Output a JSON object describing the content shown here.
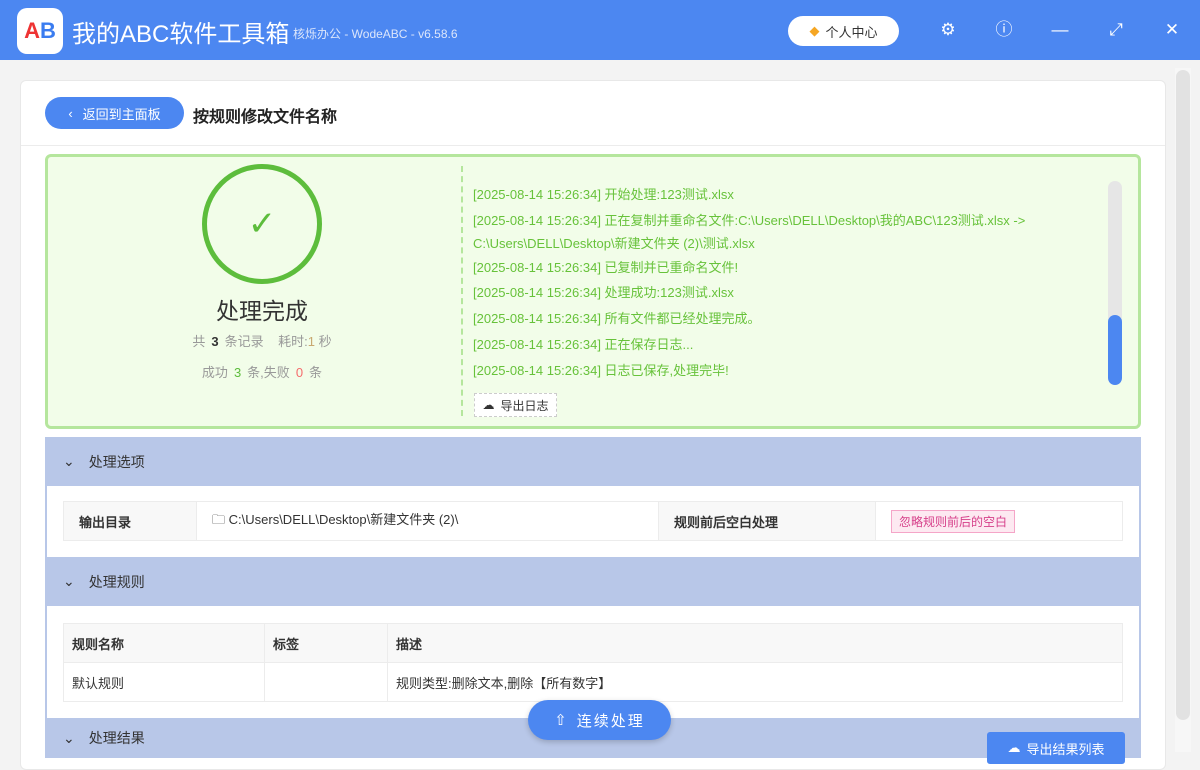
{
  "window": {
    "title": "我的ABC软件工具箱",
    "subtitle": "核烁办公 - WodeABC - v6.58.6",
    "logo_text": "AB",
    "user_center": "个人中心",
    "icons": [
      "settings-icon",
      "help-icon",
      "minimize-icon",
      "maximize-icon",
      "close-icon"
    ]
  },
  "header": {
    "back_label": "返回到主面板",
    "page_title": "按规则修改文件名称"
  },
  "summary": {
    "title": "处理完成",
    "total_prefix": "共",
    "total": "3",
    "total_suffix": "条记录",
    "time_label": "耗时:",
    "time": "1",
    "time_unit": "秒",
    "success_label": "成功",
    "success": "3",
    "success_unit": "条,",
    "fail_label": "失败",
    "fail": "0",
    "fail_unit": "条"
  },
  "log": {
    "lines": [
      "[2025-08-14 15:26:34] 开始处理:123测试.xlsx",
      "[2025-08-14 15:26:34] 正在复制并重命名文件:C:\\Users\\DELL\\Desktop\\我的ABC\\123测试.xlsx ->",
      "C:\\Users\\DELL\\Desktop\\新建文件夹 (2)\\测试.xlsx",
      "[2025-08-14 15:26:34] 已复制并已重命名文件!",
      "[2025-08-14 15:26:34] 处理成功:123测试.xlsx",
      "[2025-08-14 15:26:34] 所有文件都已经处理完成。",
      "[2025-08-14 15:26:34] 正在保存日志...",
      "[2025-08-14 15:26:34] 日志已保存,处理完毕!"
    ],
    "export_label": "导出日志",
    "scroll_fraction": 1.0
  },
  "options": {
    "title": "处理选项",
    "output_label": "输出目录",
    "output_value": "C:\\Users\\DELL\\Desktop\\新建文件夹 (2)\\",
    "trim_label": "规则前后空白处理",
    "trim_value": "忽略规则前后的空白"
  },
  "rules": {
    "title": "处理规则",
    "columns": [
      "规则名称",
      "标签",
      "描述"
    ],
    "rows": [
      [
        "默认规则",
        "",
        "规则类型:删除文本,删除【所有数字】"
      ]
    ]
  },
  "results": {
    "title": "处理结果",
    "export_label": "导出结果列表"
  },
  "continue_label": "连续处理",
  "colors": {
    "primary": "#4c87f1",
    "success": "#5dbd3c",
    "fail": "#f56c6c",
    "section": "#b8c7e8"
  }
}
